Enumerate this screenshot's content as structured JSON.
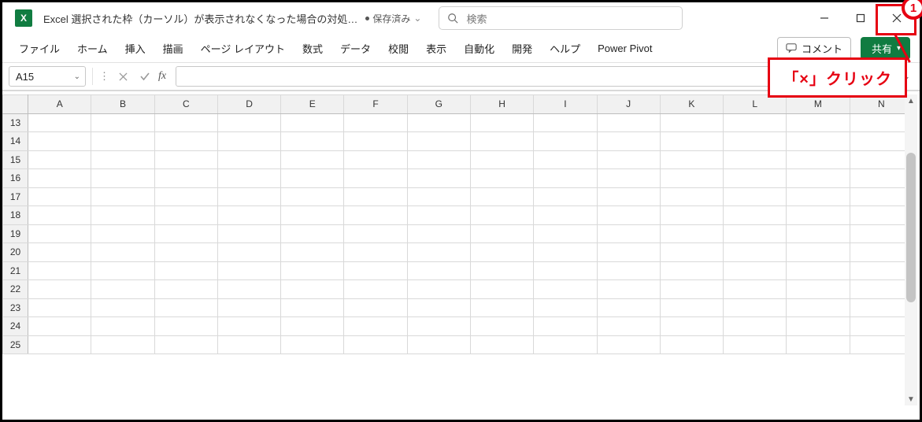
{
  "app_icon_text": "X",
  "title": "Excel 選択された枠（カーソル）が表示されなくなった場合の対処…",
  "save_state": "保存済み",
  "search_placeholder": "検索",
  "tabs": [
    "ファイル",
    "ホーム",
    "挿入",
    "描画",
    "ページ レイアウト",
    "数式",
    "データ",
    "校閲",
    "表示",
    "自動化",
    "開発",
    "ヘルプ",
    "Power Pivot"
  ],
  "comments_label": "コメント",
  "share_label": "共有",
  "namebox": "A15",
  "formula": "",
  "columns": [
    "A",
    "B",
    "C",
    "D",
    "E",
    "F",
    "G",
    "H",
    "I",
    "J",
    "K",
    "L",
    "M",
    "N"
  ],
  "rows": [
    "13",
    "14",
    "15",
    "16",
    "17",
    "18",
    "19",
    "20",
    "21",
    "22",
    "23",
    "24",
    "25"
  ],
  "annotation_badge": "1",
  "annotation_text": "「×」クリック"
}
